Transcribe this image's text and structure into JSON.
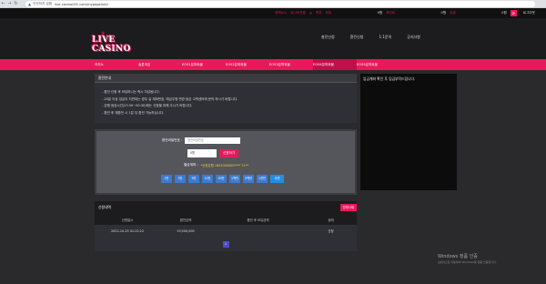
{
  "browser": {
    "secure_text": "안전하지 않음",
    "url": "live-casino001.com/mypage/xnt/"
  },
  "topbar": {
    "level": "준케노노",
    "logout": "로그아웃중",
    "messages": "쪽지",
    "money_label": "보유",
    "money_value": "0원",
    "point_label": "포인트",
    "point_value": "0원",
    "coupon_label": "쿠폰",
    "coupon_value": "0원",
    "refresh_icon": "refresh-icon",
    "logout_label": "로그아웃"
  },
  "header": {
    "logo_text": "LIVE CASINO",
    "nav": [
      "충전신청",
      "환전신청",
      "1:1문의",
      "공지사항"
    ]
  },
  "gamenav": [
    "카지노",
    "슬롯게임",
    "EOS1분파워볼",
    "EOS2분파워볼",
    "EOS3분파워볼",
    "EOS4분파워볼",
    "EOS5분파워볼"
  ],
  "notice": {
    "title": "환전안내",
    "lines": [
      "- 환전 신청 후 보유머니는 즉시 차감됩니다.",
      "- 20분 이상 입금이 지연되는 경우 실 계좌번호, 예금주명 변경 등은 고객센터에 문의 하시기 바랍니다.",
      "- 은행 점검시간(23:30~00:30)에는 신청을 피해 주시기 바랍니다.",
      "- 환전 후 재환전 시 1분 뒤 환전 가능하십니다."
    ]
  },
  "form": {
    "password_label": "환전비밀번호 :",
    "password_placeholder": "환전비밀번호",
    "amount_value": "0원",
    "submit_label": "신청하기",
    "account_label": "출금계좌 :",
    "account_value": "*신한은행 1602000000**** 71**",
    "chips": [
      "1만",
      "3만",
      "5만",
      "10만",
      "30만",
      "1백만",
      "5백만",
      "1천만",
      "리셋"
    ]
  },
  "list": {
    "title": "신청내역",
    "delete_all": "전체삭제",
    "columns": [
      "신청일시",
      "환전금액",
      "환전 후 보유금액",
      "상태"
    ],
    "rows": [
      {
        "date": "2022-10-25 01:22:22",
        "amount": "19,500,000",
        "after": "",
        "status": "신청"
      }
    ],
    "page": "1"
  },
  "right_panel": {
    "text": "입금계좌 확인 후 입금부탁드립니다."
  },
  "windows": {
    "line1": "Windows 정품 인증",
    "line2": "[설정]으로 이동하여 Windows를 정품 인증합니다."
  }
}
